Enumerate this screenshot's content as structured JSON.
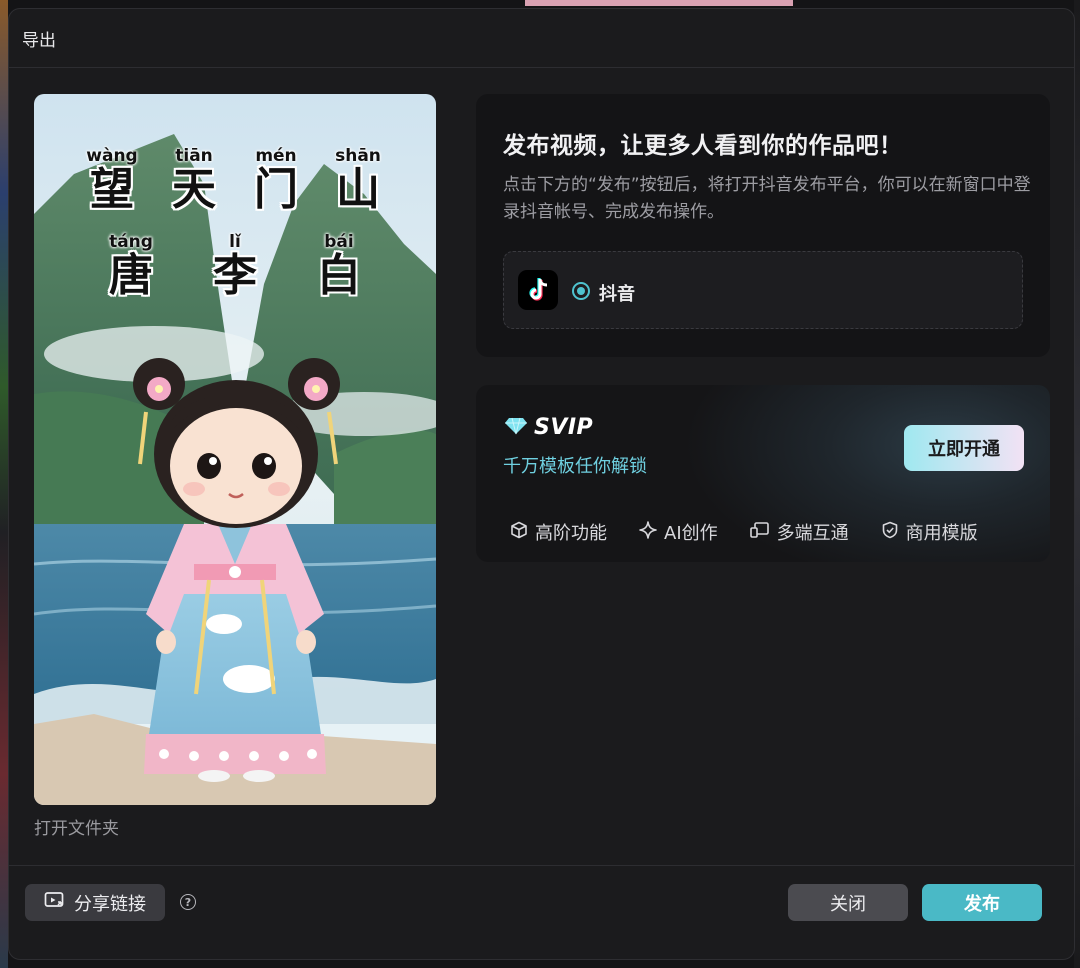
{
  "dialog": {
    "title": "导出",
    "open_folder": "打开文件夹"
  },
  "preview": {
    "poem": {
      "title_chars": [
        {
          "pinyin": "wàng",
          "hanzi": "望"
        },
        {
          "pinyin": "tiān",
          "hanzi": "天"
        },
        {
          "pinyin": "mén",
          "hanzi": "门"
        },
        {
          "pinyin": "shān",
          "hanzi": "山"
        }
      ],
      "author_chars": [
        {
          "pinyin": "táng",
          "hanzi": "唐"
        },
        {
          "pinyin": "lǐ",
          "hanzi": "李"
        },
        {
          "pinyin": "bái",
          "hanzi": "白"
        }
      ]
    }
  },
  "publish": {
    "heading": "发布视频，让更多人看到你的作品吧！",
    "description": "点击下方的“发布”按钮后，将打开抖音发布平台，你可以在新窗口中登录抖音帐号、完成发布操作。",
    "platform_label": "抖音",
    "platform_icon": "tiktok-icon"
  },
  "svip": {
    "title": "SVIP",
    "subtitle": "千万模板任你解锁",
    "cta": "立即开通",
    "features": [
      {
        "label": "高阶功能",
        "icon": "cube-icon"
      },
      {
        "label": "AI创作",
        "icon": "sparkle-icon"
      },
      {
        "label": "多端互通",
        "icon": "devices-icon"
      },
      {
        "label": "商用模版",
        "icon": "shield-check-icon"
      }
    ]
  },
  "footer": {
    "share_label": "分享链接",
    "help": "?",
    "close_label": "关闭",
    "publish_label": "发布"
  },
  "colors": {
    "accent": "#4ab9c6",
    "dialog_bg": "#1b1b1d",
    "card_bg": "#141416",
    "svip_sub": "#6fd0e0"
  }
}
